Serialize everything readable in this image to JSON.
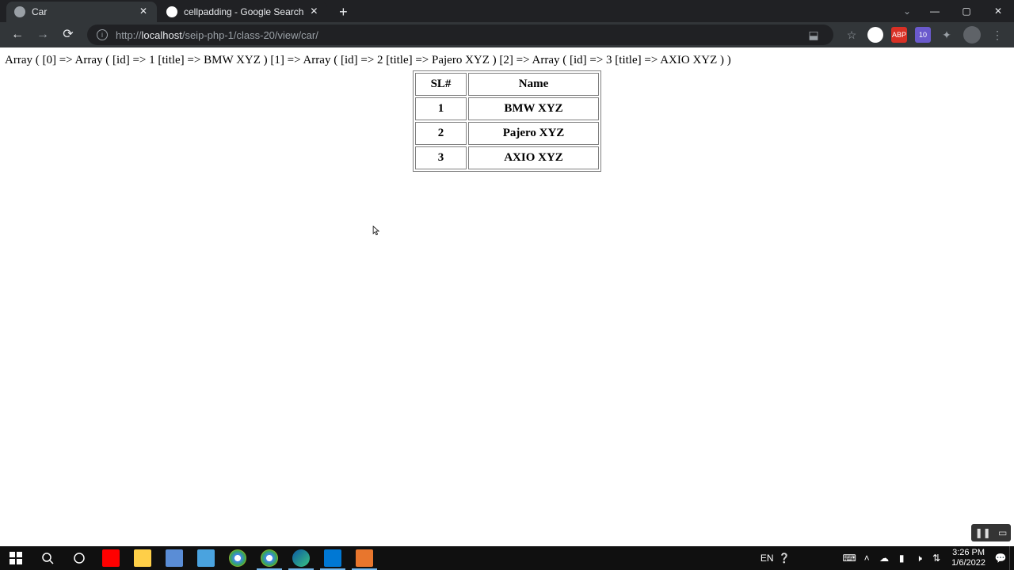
{
  "browser": {
    "tabs": [
      {
        "title": "Car",
        "active": true
      },
      {
        "title": "cellpadding - Google Search",
        "active": false
      }
    ],
    "url_prefix": "http://",
    "url_host": "localhost",
    "url_path": "/seip-php-1/class-20/view/car/",
    "ext_badges": [
      {
        "label": "",
        "bg": "#ffffff"
      },
      {
        "label": "ABP",
        "bg": "#d93025"
      },
      {
        "label": "10",
        "bg": "#6a5acd"
      }
    ]
  },
  "page": {
    "array_dump": "Array ( [0] => Array ( [id] => 1 [title] => BMW XYZ ) [1] => Array ( [id] => 2 [title] => Pajero XYZ ) [2] => Array ( [id] => 3 [title] => AXIO XYZ ) )",
    "table": {
      "headers": {
        "sl": "SL#",
        "name": "Name"
      },
      "rows": [
        {
          "sl": "1",
          "name": "BMW XYZ"
        },
        {
          "sl": "2",
          "name": "Pajero XYZ"
        },
        {
          "sl": "3",
          "name": "AXIO XYZ"
        }
      ]
    }
  },
  "taskbar": {
    "lang": "EN",
    "time": "3:26 PM",
    "date": "1/6/2022"
  }
}
